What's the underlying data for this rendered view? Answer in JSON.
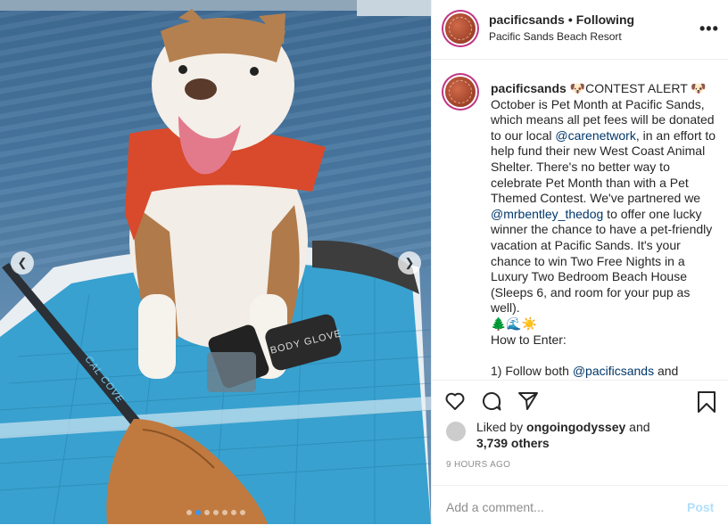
{
  "header": {
    "username": "pacificsands",
    "separator": "•",
    "follow_status": "Following",
    "location": "Pacific Sands Beach Resort",
    "more_icon": "•••"
  },
  "caption": {
    "username": "pacificsands",
    "line_parts": [
      "🐶CONTEST ALERT 🐶 October is Pet Month at Pacific Sands, which means all pet fees will be donated to our local ",
      "@carenetwork",
      ", in an effort to help fund their new West Coast Animal Shelter. There's no better way to celebrate Pet Month than with a Pet Themed Contest. We've partnered we ",
      "@mrbentley_thedog",
      " to offer one lucky winner the chance to have a pet-friendly vacation at Pacific Sands. It's your chance to win Two Free Nights in a Luxury Two Bedroom Beach House (Sleeps 6, and room for your pup as well).",
      "🌲🌊☀️",
      "How to Enter:",
      "1) Follow both ",
      "@pacificsands",
      " and"
    ]
  },
  "actions": {
    "like_icon": "heart-icon",
    "comment_icon": "comment-icon",
    "share_icon": "paper-plane-icon",
    "save_icon": "bookmark-icon"
  },
  "likes": {
    "prefix": "Liked by ",
    "liker": "ongoingodyssey",
    "middle": " and",
    "count": "3,739 others"
  },
  "timestamp": "9 HOURS AGO",
  "comment": {
    "placeholder": "Add a comment...",
    "post_label": "Post"
  },
  "media": {
    "paddle_text": "CAL COVE",
    "glove_text": "BODY GLOVE",
    "carousel_total": 7,
    "carousel_active": 2
  },
  "colors": {
    "accent": "#3897f0",
    "mention": "#00376b",
    "post_disabled": "#b2dffc"
  }
}
